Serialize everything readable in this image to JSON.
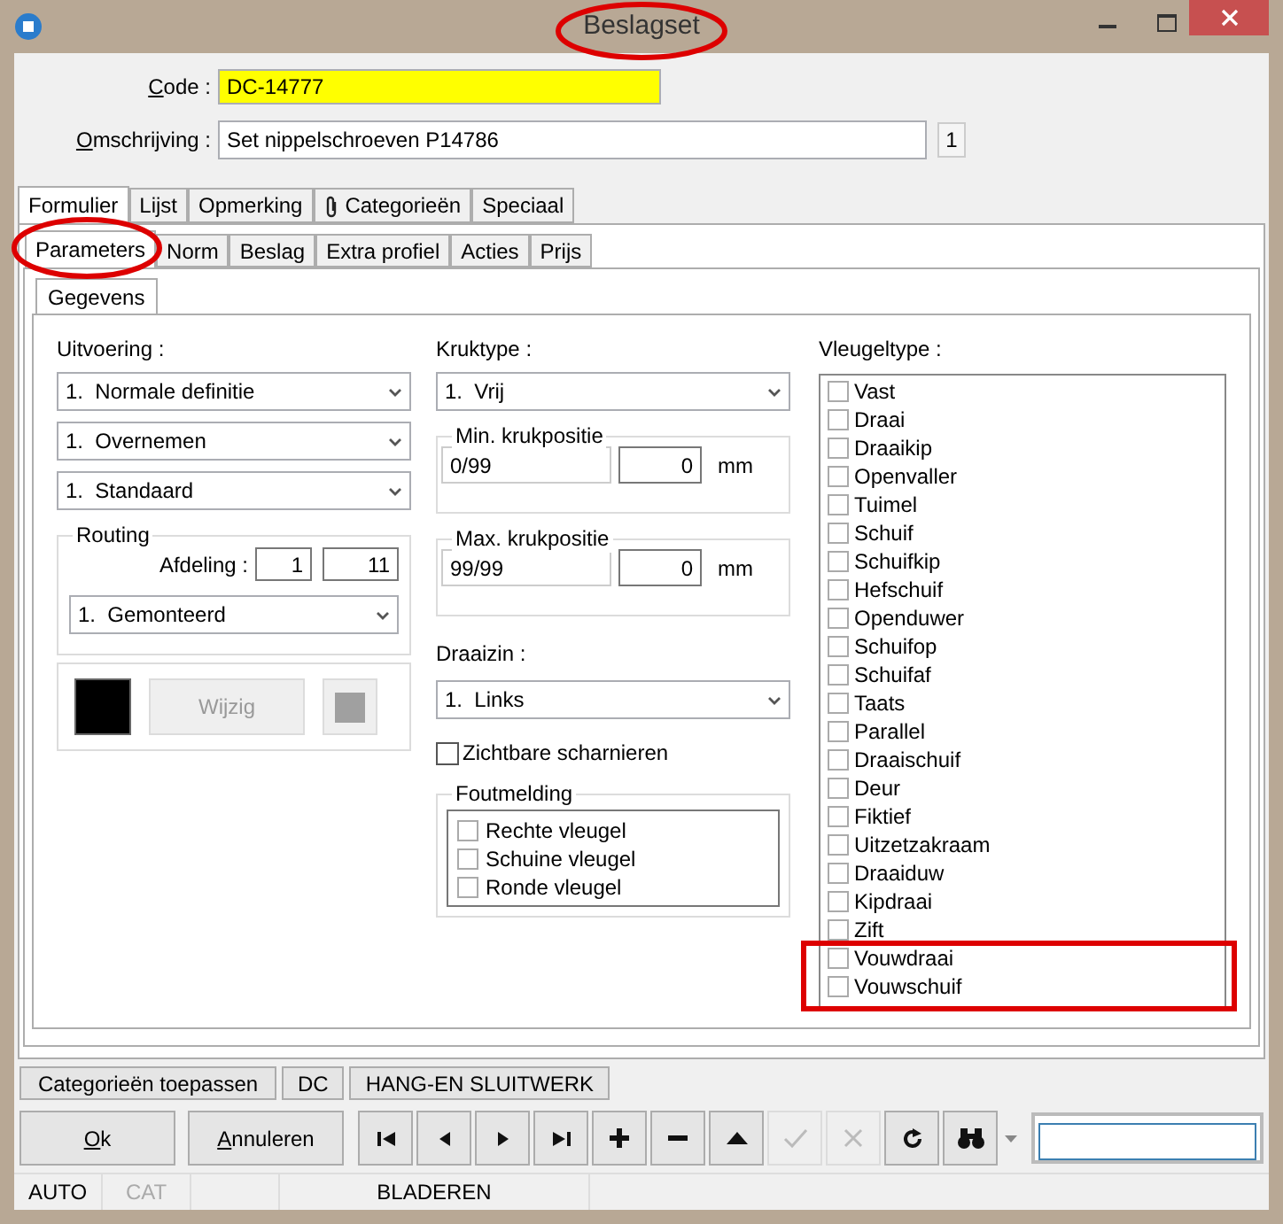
{
  "window": {
    "title": "Beslagset"
  },
  "code": {
    "label": "Code :",
    "value": "DC-14777"
  },
  "omschrijving": {
    "label": "Omschrijving :",
    "value": "Set nippelschroeven P14786",
    "counter": "1"
  },
  "tabs": [
    {
      "label": "Formulier",
      "selected": true,
      "kind": "text"
    },
    {
      "label": "Lijst",
      "selected": false,
      "kind": "text"
    },
    {
      "label": "Opmerking",
      "selected": false,
      "kind": "text"
    },
    {
      "label": "Categorieën",
      "selected": false,
      "kind": "clip"
    },
    {
      "label": "Speciaal",
      "selected": false,
      "kind": "text"
    }
  ],
  "subtabs": [
    {
      "label": "Parameters",
      "selected": true
    },
    {
      "label": "Norm",
      "selected": false
    },
    {
      "label": "Beslag",
      "selected": false
    },
    {
      "label": "Extra profiel",
      "selected": false
    },
    {
      "label": "Acties",
      "selected": false
    },
    {
      "label": "Prijs",
      "selected": false
    }
  ],
  "inner_tab": {
    "label": "Gegevens",
    "selected": true
  },
  "uitvoering": {
    "label": "Uitvoering :",
    "selects": [
      "1.  Normale definitie",
      "1.  Overnemen",
      "1.  Standaard"
    ]
  },
  "routing": {
    "title": "Routing",
    "afdeling_label": "Afdeling :",
    "afdeling_1": "1",
    "afdeling_2": "11",
    "select": "1.  Gemonteerd"
  },
  "color_panel": {
    "button": "Wijzig",
    "button_disabled": true
  },
  "kruktype": {
    "label": "Kruktype :",
    "select": "1.  Vrij"
  },
  "min_krukpositie": {
    "title": "Min. krukpositie",
    "range": "0/99",
    "value": "0",
    "unit": "mm"
  },
  "max_krukpositie": {
    "title": "Max. krukpositie",
    "range": "99/99",
    "value": "0",
    "unit": "mm"
  },
  "draaizin": {
    "label": "Draaizin :",
    "select": "1.  Links"
  },
  "zichtbare_scharnieren": {
    "label": "Zichtbare scharnieren",
    "checked": false
  },
  "foutmelding": {
    "title": "Foutmelding",
    "items": [
      {
        "label": "Rechte vleugel",
        "checked": false
      },
      {
        "label": "Schuine vleugel",
        "checked": false
      },
      {
        "label": "Ronde vleugel",
        "checked": false
      }
    ]
  },
  "vleugeltype": {
    "label": "Vleugeltype :",
    "items": [
      {
        "label": "Vast",
        "checked": false
      },
      {
        "label": "Draai",
        "checked": false
      },
      {
        "label": "Draaikip",
        "checked": false
      },
      {
        "label": "Openvaller",
        "checked": false
      },
      {
        "label": "Tuimel",
        "checked": false
      },
      {
        "label": "Schuif",
        "checked": false
      },
      {
        "label": "Schuifkip",
        "checked": false
      },
      {
        "label": "Hefschuif",
        "checked": false
      },
      {
        "label": "Openduwer",
        "checked": false
      },
      {
        "label": "Schuifop",
        "checked": false
      },
      {
        "label": "Schuifaf",
        "checked": false
      },
      {
        "label": "Taats",
        "checked": false
      },
      {
        "label": "Parallel",
        "checked": false
      },
      {
        "label": "Draaischuif",
        "checked": false
      },
      {
        "label": "Deur",
        "checked": false
      },
      {
        "label": "Fiktief",
        "checked": false
      },
      {
        "label": "Uitzetzakraam",
        "checked": false
      },
      {
        "label": "Draaiduw",
        "checked": false
      },
      {
        "label": "Kipdraai",
        "checked": false
      },
      {
        "label": "Zift",
        "checked": false
      },
      {
        "label": "Vouwdraai",
        "checked": false
      },
      {
        "label": "Vouwschuif",
        "checked": false
      }
    ]
  },
  "category_buttons": [
    "Categorieën toepassen",
    "DC",
    "HANG-EN SLUITWERK"
  ],
  "ok_button": {
    "mnemonic": "O",
    "rest": "k"
  },
  "cancel_button": {
    "mnemonic": "A",
    "rest": "nnuleren"
  },
  "nav_buttons": [
    {
      "kind": "first",
      "disabled": false
    },
    {
      "kind": "prev",
      "disabled": false
    },
    {
      "kind": "next",
      "disabled": false
    },
    {
      "kind": "last",
      "disabled": false
    },
    {
      "kind": "add",
      "disabled": false
    },
    {
      "kind": "remove",
      "disabled": false
    },
    {
      "kind": "up",
      "disabled": false
    },
    {
      "kind": "confirm",
      "disabled": true
    },
    {
      "kind": "cancel",
      "disabled": true
    },
    {
      "kind": "refresh",
      "disabled": false
    },
    {
      "kind": "find",
      "disabled": false
    }
  ],
  "status_bar": [
    {
      "label": "AUTO",
      "disabled": false
    },
    {
      "label": "CAT",
      "disabled": true
    },
    {
      "label": "BLADEREN",
      "disabled": false
    }
  ]
}
